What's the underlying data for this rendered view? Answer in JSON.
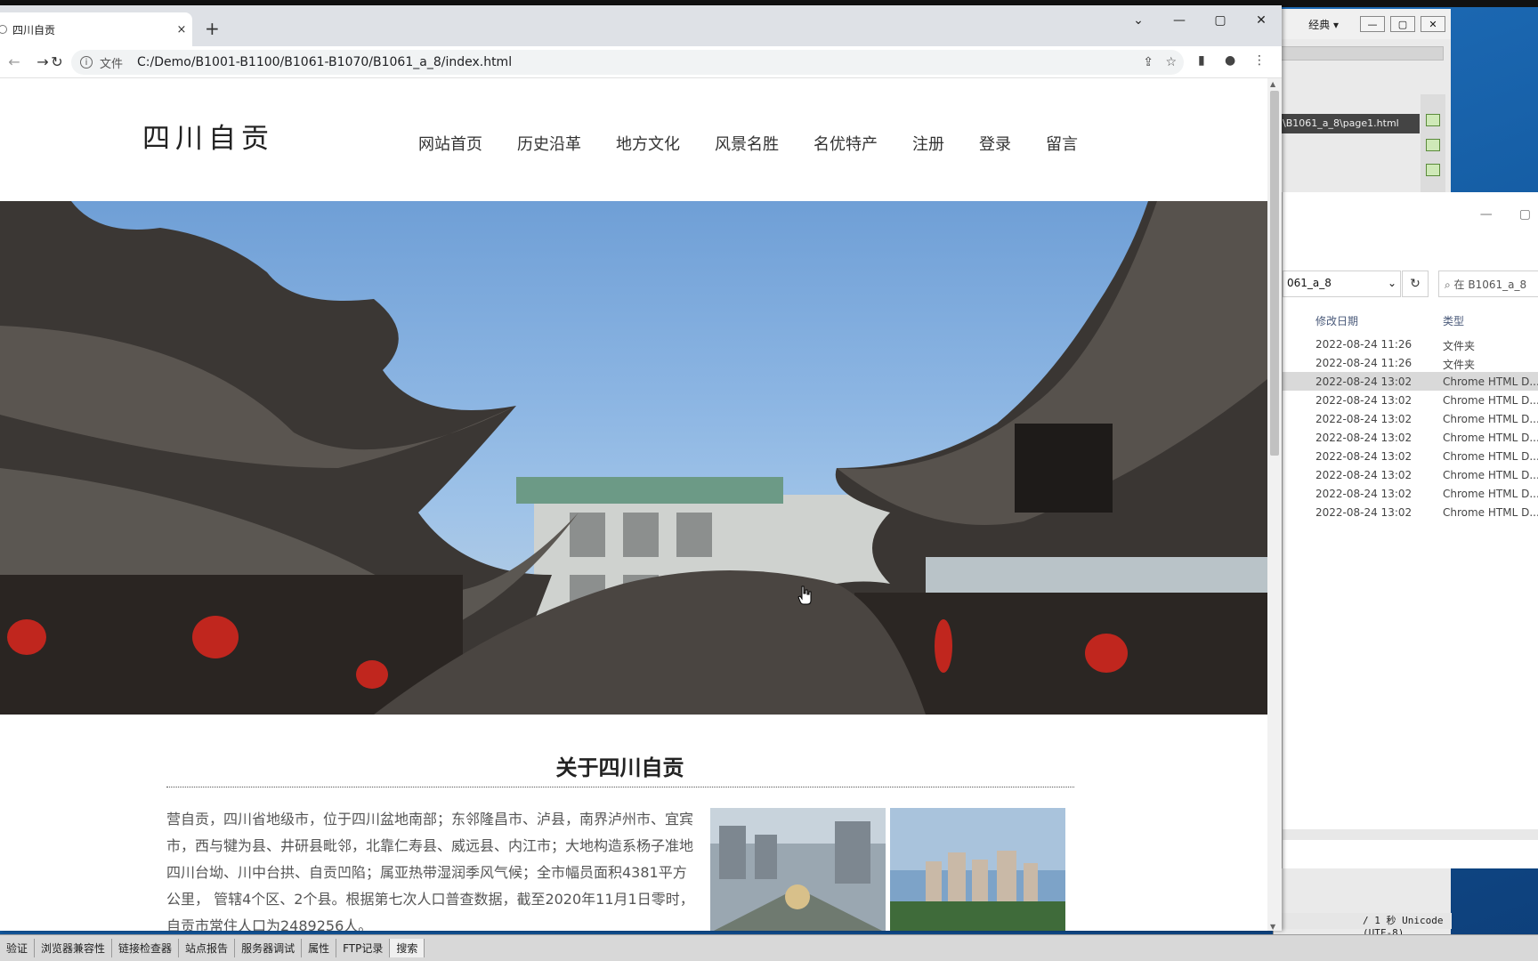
{
  "dreamweaver": {
    "workspace_mode": "经典",
    "doc_path": "\\B1061_a_8\\page1.html",
    "status_right": "/ 1 秒 Unicode (UTF-8)",
    "panel_tabs": [
      "验证",
      "浏览器兼容性",
      "链接检查器",
      "站点报告",
      "服务器调试",
      "属性",
      "FTP记录",
      "搜索"
    ]
  },
  "explorer": {
    "address": "061_a_8",
    "search_placeholder": "在 B1061_a_8",
    "columns": [
      "修改日期",
      "类型"
    ],
    "rows": [
      {
        "date": "2022-08-24 11:26",
        "type": "文件夹"
      },
      {
        "date": "2022-08-24 11:26",
        "type": "文件夹"
      },
      {
        "date": "2022-08-24 13:02",
        "type": "Chrome HTML D..."
      },
      {
        "date": "2022-08-24 13:02",
        "type": "Chrome HTML D..."
      },
      {
        "date": "2022-08-24 13:02",
        "type": "Chrome HTML D..."
      },
      {
        "date": "2022-08-24 13:02",
        "type": "Chrome HTML D..."
      },
      {
        "date": "2022-08-24 13:02",
        "type": "Chrome HTML D..."
      },
      {
        "date": "2022-08-24 13:02",
        "type": "Chrome HTML D..."
      },
      {
        "date": "2022-08-24 13:02",
        "type": "Chrome HTML D..."
      },
      {
        "date": "2022-08-24 13:02",
        "type": "Chrome HTML D..."
      }
    ],
    "selected_row": 2
  },
  "browser": {
    "tab_title": "四川自贡",
    "new_tab": "+",
    "close_tab": "×",
    "scheme_label": "文件",
    "url": "C:/Demo/B1001-B1100/B1061-B1070/B1061_a_8/index.html"
  },
  "site": {
    "logo": "四川自贡",
    "nav": [
      "网站首页",
      "历史沿革",
      "地方文化",
      "风景名胜",
      "名优特产",
      "注册",
      "登录",
      "留言"
    ],
    "about_title": "关于四川自贡",
    "about_text": "营自贡，四川省地级市，位于四川盆地南部；东邻隆昌市、泸县，南界泸州市、宜宾市，西与犍为县、井研县毗邻，北靠仁寿县、威远县、内江市；大地构造系杨子准地四川台坳、川中台拱、自贡凹陷；属亚热带湿润季风气候；全市幅员面积4381平方公里， 管辖4个区、2个县。根据第七次人口普查数据，截至2020年11月1日零时，自贡市常住人口为2489256人。"
  },
  "colors": {
    "sky": "#8db6e3",
    "roof": "#3a3633",
    "lantern": "#c0261e",
    "chrome_tabstrip": "#dee1e6"
  }
}
